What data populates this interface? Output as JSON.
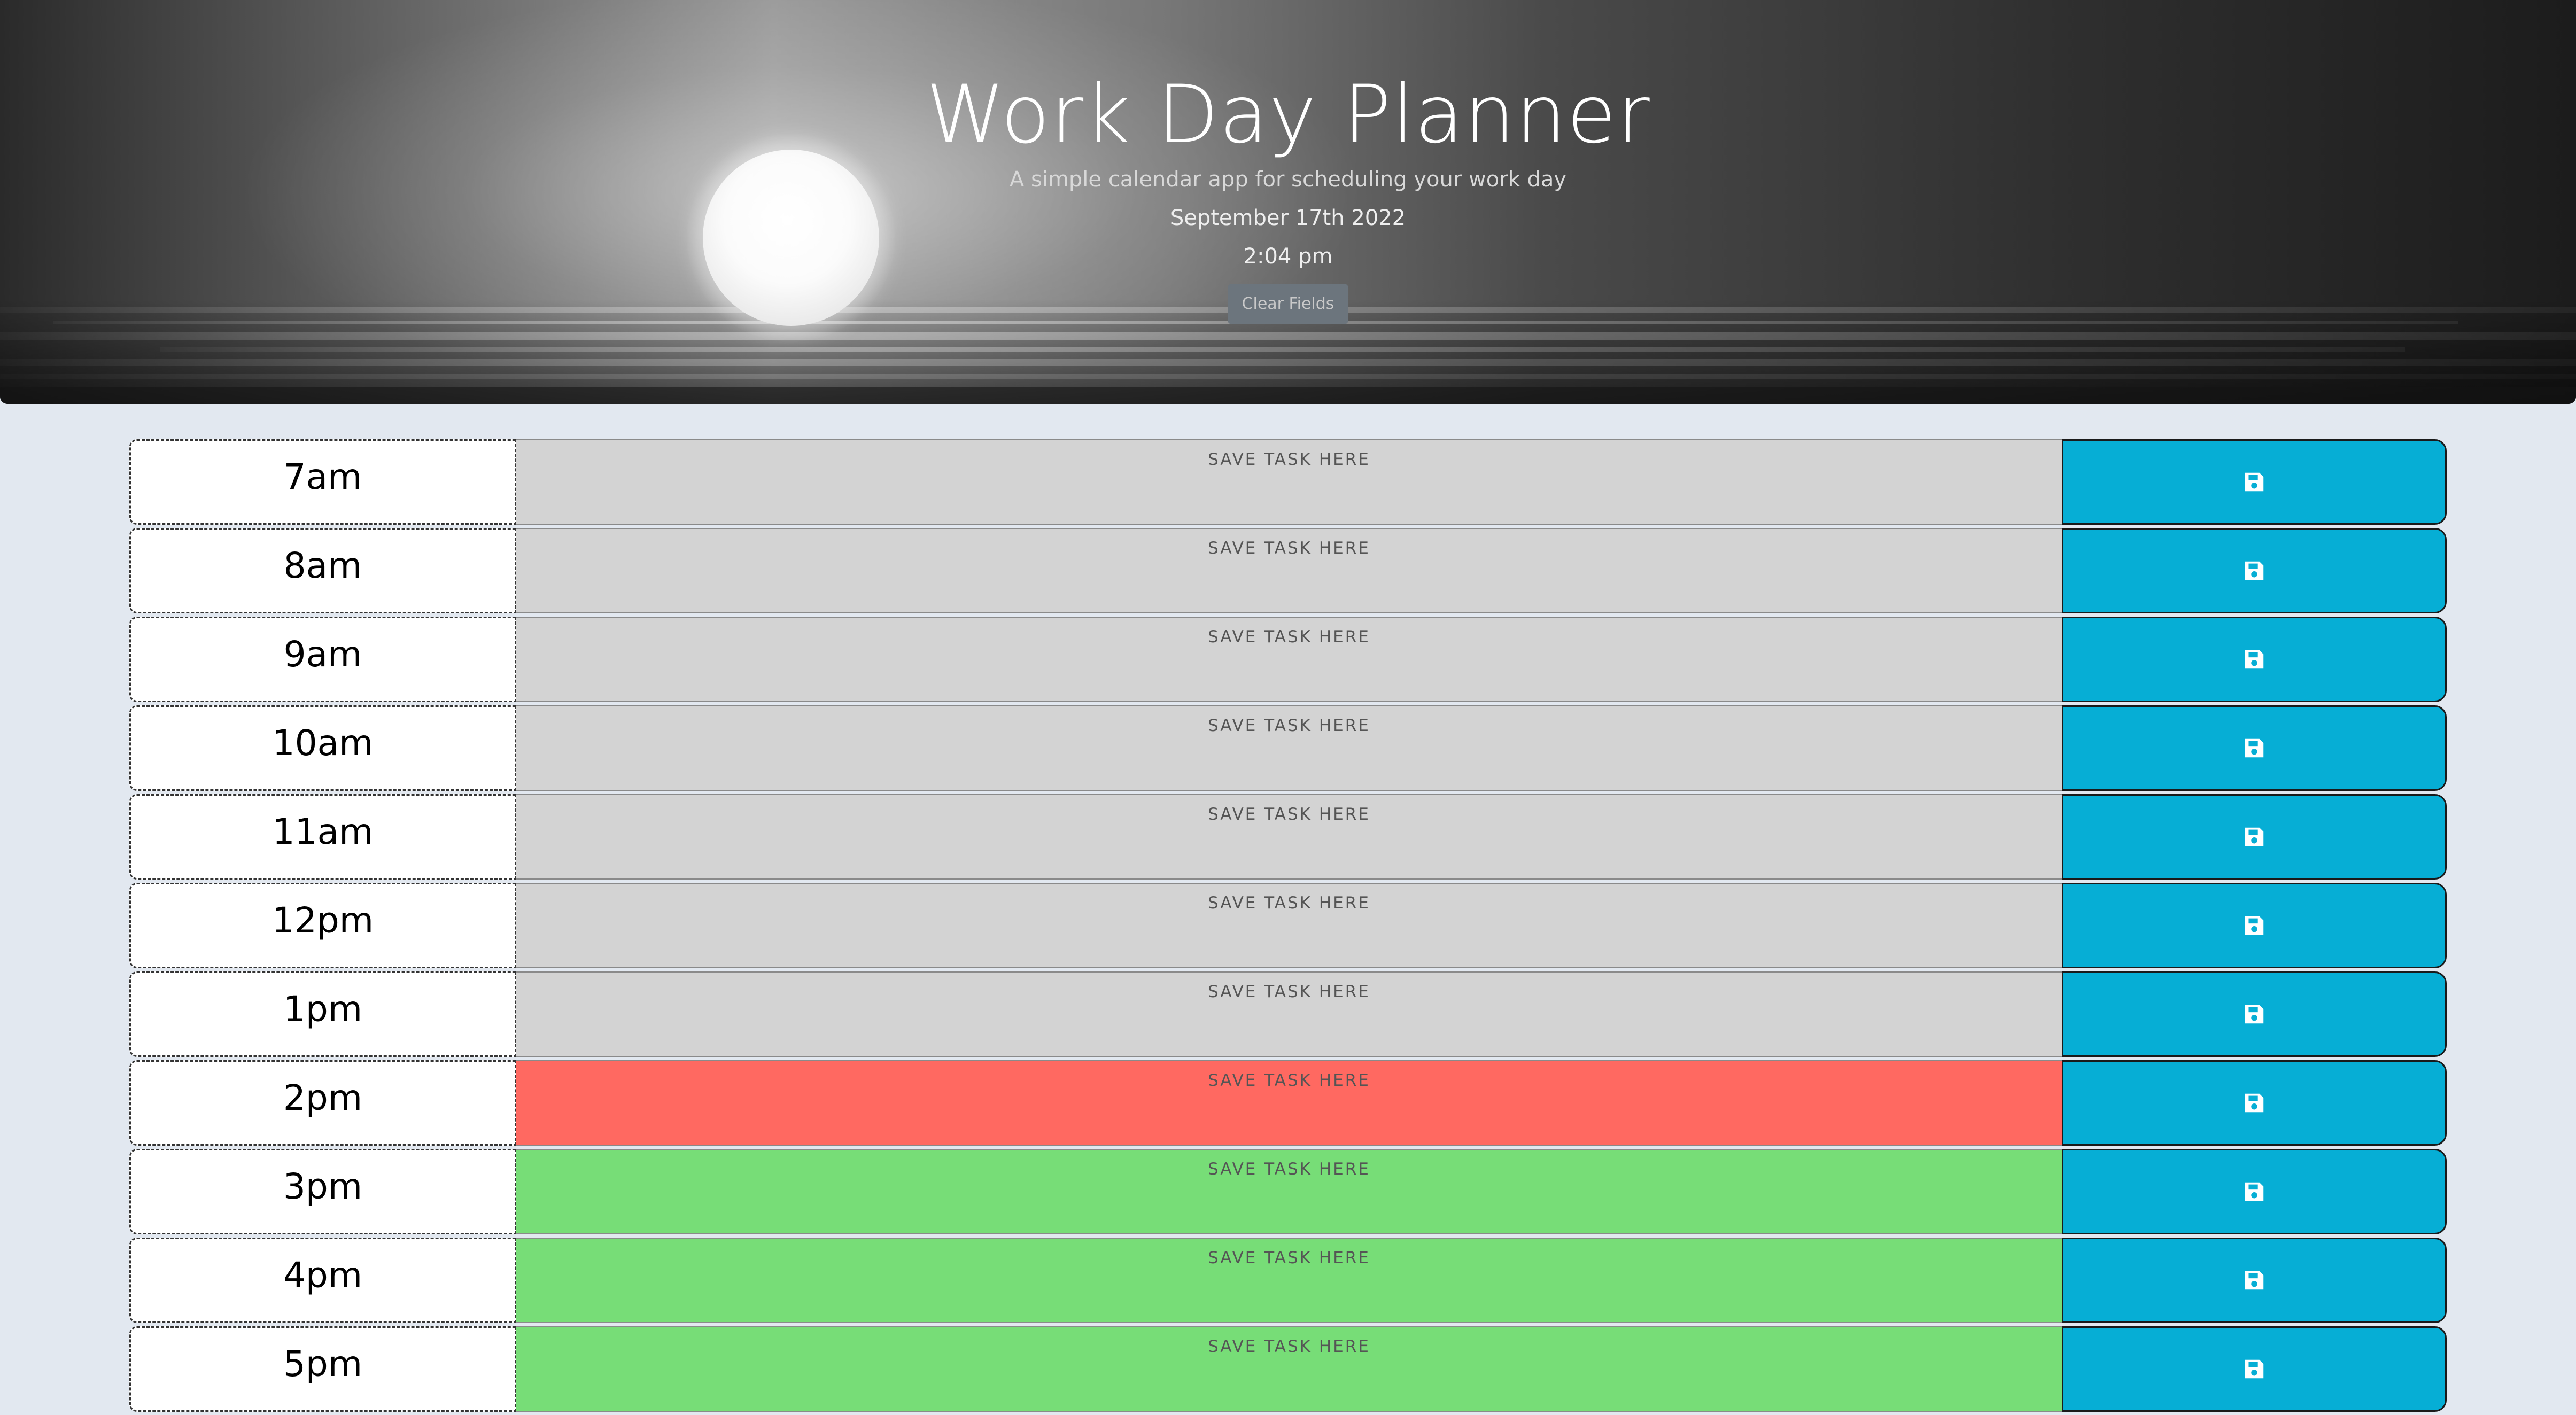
{
  "header": {
    "title": "Work Day Planner",
    "subtitle": "A simple calendar app for scheduling your work day",
    "date": "September 17th 2022",
    "time": "2:04 pm",
    "clear_button_label": "Clear Fields"
  },
  "planner": {
    "placeholder": "SAVE TASK HERE",
    "save_icon": "floppy-disk-save-icon",
    "colors": {
      "past": "#d3d3d3",
      "present": "#ff6961",
      "future": "#77dd77",
      "save_button": "#06aed5",
      "page_background": "#e2e8f0"
    },
    "rows": [
      {
        "hour": "7am",
        "state": "past"
      },
      {
        "hour": "8am",
        "state": "past"
      },
      {
        "hour": "9am",
        "state": "past"
      },
      {
        "hour": "10am",
        "state": "past"
      },
      {
        "hour": "11am",
        "state": "past"
      },
      {
        "hour": "12pm",
        "state": "past"
      },
      {
        "hour": "1pm",
        "state": "past"
      },
      {
        "hour": "2pm",
        "state": "present"
      },
      {
        "hour": "3pm",
        "state": "future"
      },
      {
        "hour": "4pm",
        "state": "future"
      },
      {
        "hour": "5pm",
        "state": "future"
      }
    ]
  }
}
